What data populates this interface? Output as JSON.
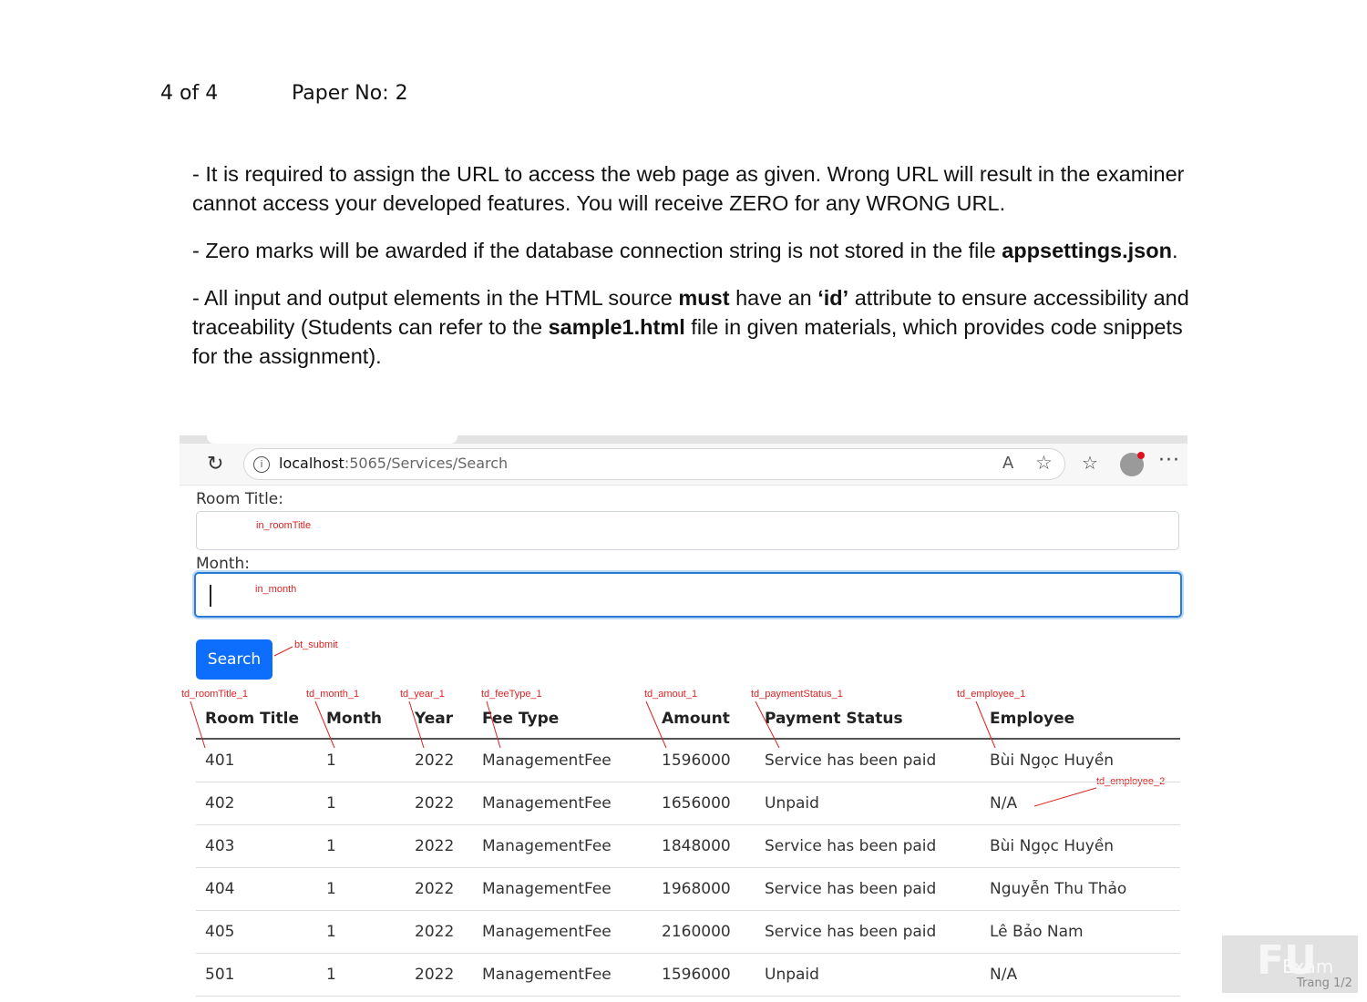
{
  "header": {
    "page": "4 of 4",
    "paper_no": "Paper No: 2"
  },
  "notes": {
    "n1": "-  It is required to assign the URL to access the web page as given. Wrong URL will result in the examiner cannot access your developed features. You will receive ZERO for any WRONG URL.",
    "n2_a": "- Zero marks will be awarded if the database connection string is not stored in the file ",
    "n2_b": "appsettings.json",
    "n2_c": ".",
    "n3_a": "-   All input and output elements in the HTML source ",
    "n3_b": "must",
    "n3_c": " have an ",
    "n3_d": "‘id’",
    "n3_e": " attribute to ensure accessibility and traceability (Students can refer to the ",
    "n3_f": "sample1.html",
    "n3_g": " file in given materials, which provides code snippets for the assignment)."
  },
  "browser": {
    "url_host": "localhost",
    "url_path": ":5065/Services/Search",
    "reload_icon": "reload-icon",
    "info_icon": "info-icon"
  },
  "form": {
    "room_title_label": "Room Title:",
    "month_label": "Month:",
    "search_button": "Search"
  },
  "annotations": {
    "in_roomTitle": "in_roomTitle",
    "in_month": "in_month",
    "bt_submit": "bt_submit",
    "td_roomTitle_1": "td_roomTitle_1",
    "td_month_1": "td_month_1",
    "td_year_1": "td_year_1",
    "td_feeType_1": "td_feeType_1",
    "td_amout_1": "td_amout_1",
    "td_paymentStatus_1": "td_paymentStatus_1",
    "td_employee_1": "td_employee_1",
    "td_employee_2": "td_employee_2"
  },
  "table": {
    "headers": [
      "Room Title",
      "Month",
      "Year",
      "Fee Type",
      "Amount",
      "Payment Status",
      "Employee"
    ],
    "rows": [
      [
        "401",
        "1",
        "2022",
        "ManagementFee",
        "1596000",
        "Service has been paid",
        "Bùi Ngọc Huyền"
      ],
      [
        "402",
        "1",
        "2022",
        "ManagementFee",
        "1656000",
        "Unpaid",
        "N/A"
      ],
      [
        "403",
        "1",
        "2022",
        "ManagementFee",
        "1848000",
        "Service has been paid",
        "Bùi Ngọc Huyền"
      ],
      [
        "404",
        "1",
        "2022",
        "ManagementFee",
        "1968000",
        "Service has been paid",
        "Nguyễn Thu Thảo"
      ],
      [
        "405",
        "1",
        "2022",
        "ManagementFee",
        "2160000",
        "Service has been paid",
        "Lê Bảo Nam"
      ],
      [
        "501",
        "1",
        "2022",
        "ManagementFee",
        "1596000",
        "Unpaid",
        "N/A"
      ]
    ]
  },
  "watermark": {
    "logo": "FU",
    "word": "Exam",
    "trang": "Trang 1/2"
  }
}
